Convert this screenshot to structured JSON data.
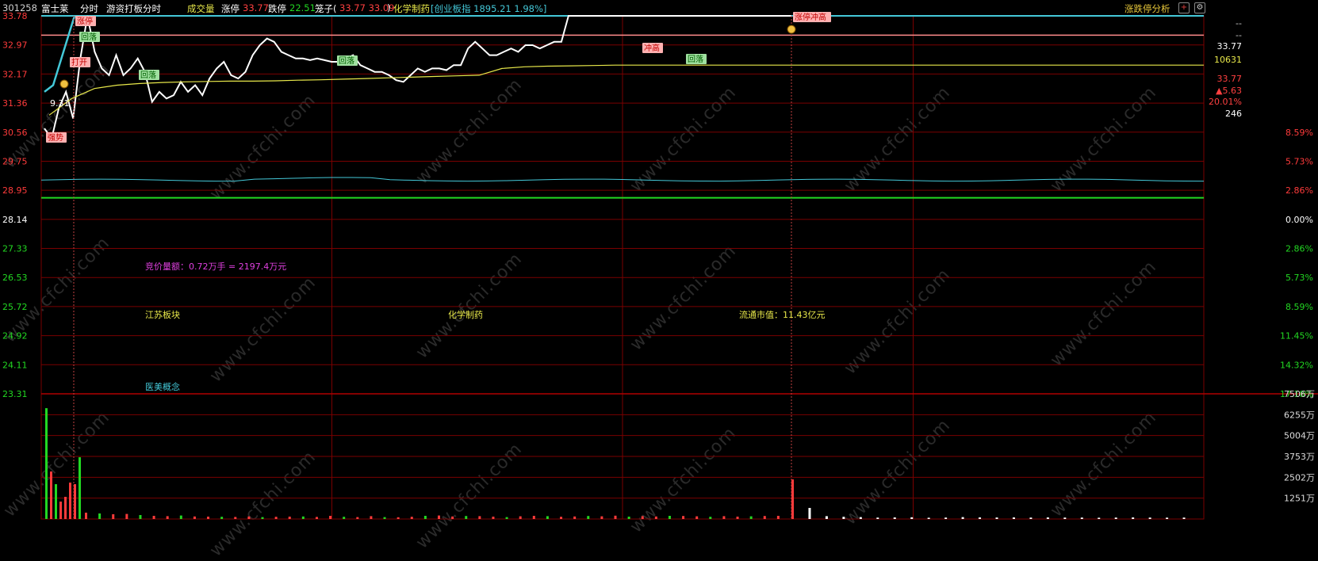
{
  "header": {
    "code": "301258",
    "name": "富士莱",
    "view": "分时",
    "mode": "游资打板分时",
    "indicator": "成交量",
    "limit_up_label": "涨停",
    "limit_up_value": "33.77",
    "limit_down_label": "跌停",
    "limit_down_value": "22.51",
    "cage_label": "笼子(",
    "cage_values": "33.77 33.09",
    "cage_close": ")",
    "sector": "化学制药",
    "index_text": "[创业板指 1895.21 1.98%]",
    "right_title": "涨跌停分析"
  },
  "colors": {
    "price": "#ffffff",
    "avg": "#e8e84a",
    "limit_line": "#ff8c8c",
    "cyan": "#44c8d8",
    "green": "#22d822",
    "red": "#ff3b3b",
    "grid": "#7a0000"
  },
  "right_panel": {
    "dash1": "--",
    "dash2": "--",
    "price": "33.77",
    "volume": "10631",
    "price2": "33.77",
    "change": "▲5.63",
    "pct": "20.01%",
    "count": "246"
  },
  "texts": {
    "auction": "竞价量额：0.72万手 = 2197.4万元",
    "region": "江苏板块",
    "sector": "化学制药",
    "float_cap": "流通市值：11.43亿元",
    "concept": "医美概念",
    "small_val": "9.31"
  },
  "watermark": "www.cfchi.com",
  "chart_data": {
    "type": "line",
    "price_axis_left": [
      "33.78",
      "32.97",
      "32.17",
      "31.36",
      "30.56",
      "29.75",
      "28.95",
      "28.14",
      "27.33",
      "26.53",
      "25.72",
      "24.92",
      "24.11",
      "23.31"
    ],
    "pct_axis_right": [
      "",
      "",
      "",
      "",
      "8.59%",
      "5.73%",
      "2.86%",
      "0.00%",
      "2.86%",
      "5.73%",
      "8.59%",
      "11.45%",
      "14.32%",
      "17.18%"
    ],
    "volume_axis": [
      "7506万",
      "6255万",
      "5004万",
      "3753万",
      "2502万",
      "1251万"
    ],
    "limit_up": 33.77,
    "prev_close": 28.14,
    "price_series": [
      30.4,
      30.1,
      31.0,
      31.5,
      30.7,
      32.5,
      33.78,
      32.7,
      32.2,
      32.0,
      32.6,
      32.0,
      32.2,
      32.5,
      32.1,
      31.2,
      31.5,
      31.3,
      31.4,
      31.8,
      31.5,
      31.7,
      31.4,
      31.9,
      32.2,
      32.4,
      32.0,
      31.9,
      32.1,
      32.6,
      32.9,
      33.1,
      33.0,
      32.7,
      32.6,
      32.5,
      32.5,
      32.45,
      32.5,
      32.45,
      32.4,
      32.4,
      32.5,
      32.6,
      32.3,
      32.2,
      32.1,
      32.1,
      32.0,
      31.85,
      31.8,
      32.0,
      32.2,
      32.1,
      32.2,
      32.2,
      32.15,
      32.3,
      32.3,
      32.8,
      33.0,
      32.8,
      32.6,
      32.6,
      32.7,
      32.8,
      32.7,
      32.9,
      32.9,
      32.8,
      32.9,
      33.0,
      33.0,
      33.78,
      33.78,
      33.78,
      33.78,
      33.78,
      33.78,
      33.78,
      33.78,
      33.78,
      33.78,
      33.78,
      33.78,
      33.78,
      33.78,
      33.78,
      33.78,
      33.78,
      33.78,
      33.78,
      33.78,
      33.78,
      33.78,
      33.78,
      33.78,
      33.78,
      33.78,
      33.78,
      33.78,
      33.78,
      33.78,
      33.78,
      33.78
    ],
    "avg_series": [
      30.8,
      31.3,
      31.6,
      31.7,
      31.75,
      31.78,
      31.8,
      31.81,
      31.82,
      31.82,
      31.83,
      31.85,
      31.86,
      31.88,
      31.9,
      31.92,
      31.94,
      31.96,
      31.98,
      32.0,
      32.2,
      32.25,
      32.27,
      32.28,
      32.29,
      32.3,
      32.3,
      32.3,
      32.3,
      32.3,
      32.3,
      32.3,
      32.3,
      32.3,
      32.3,
      32.3,
      32.3,
      32.3,
      32.3,
      32.3,
      32.3,
      32.3,
      32.3,
      32.3,
      32.3,
      32.3,
      32.3,
      32.3,
      32.3,
      32.3,
      32.3,
      32.3
    ],
    "volume": [
      7000,
      3000,
      2200,
      1100,
      1400,
      2300,
      2200,
      3900,
      400,
      350,
      300,
      320,
      250,
      200,
      180,
      220,
      160,
      150,
      140,
      130,
      160,
      120,
      140,
      150,
      160,
      130,
      200,
      140,
      120,
      180,
      120,
      110,
      140,
      200,
      220,
      160,
      190,
      180,
      150,
      120,
      170,
      200,
      180,
      140,
      160,
      190,
      170,
      210,
      150,
      180,
      160,
      200,
      190,
      170,
      140,
      180,
      150,
      170,
      190,
      200,
      2500,
      700,
      180,
      140,
      120,
      90,
      100,
      110,
      80,
      90,
      120,
      100,
      95,
      100,
      90,
      100,
      90,
      90,
      80,
      90,
      100,
      90,
      85,
      90
    ],
    "annotations": [
      {
        "text": "涨停",
        "kind": "up"
      },
      {
        "text": "回落",
        "kind": "down"
      },
      {
        "text": "打开",
        "kind": "up"
      },
      {
        "text": "回落",
        "kind": "down"
      },
      {
        "text": "回落",
        "kind": "down"
      },
      {
        "text": "冲高",
        "kind": "up"
      },
      {
        "text": "回落",
        "kind": "down"
      },
      {
        "text": "涨停冲高",
        "kind": "up"
      },
      {
        "text": "强势",
        "kind": "up"
      }
    ]
  }
}
